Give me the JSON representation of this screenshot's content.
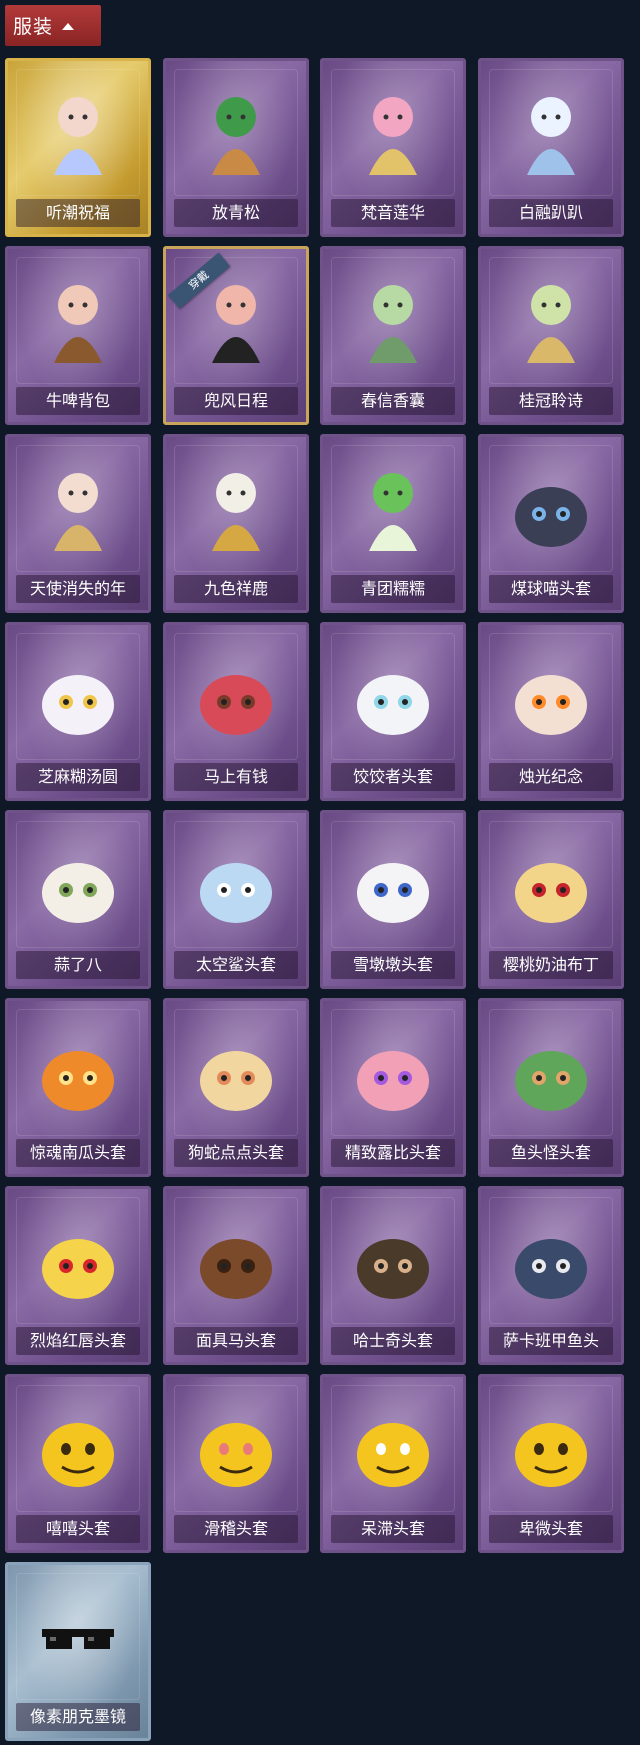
{
  "header": {
    "label": "服装"
  },
  "colors": {
    "background": "#0f1826",
    "header_button": "#9a2c2c",
    "card_purple": "#7a5b96",
    "card_gold": "#d7b548",
    "card_blue": "#94aec4"
  },
  "items": [
    {
      "name": "听潮祝福",
      "tier": "gold",
      "icon": "angel-figure-icon"
    },
    {
      "name": "放青松",
      "tier": "purple",
      "icon": "bonsai-pine-icon"
    },
    {
      "name": "梵音莲华",
      "tier": "purple",
      "icon": "pink-hair-figure-icon"
    },
    {
      "name": "白融趴趴",
      "tier": "purple",
      "icon": "white-cat-plush-icon"
    },
    {
      "name": "牛啤背包",
      "tier": "purple",
      "icon": "cow-beer-barrel-icon"
    },
    {
      "name": "兜风日程",
      "tier": "purple",
      "icon": "cap-girl-figure-icon",
      "equipped": true,
      "badge": "穿戴"
    },
    {
      "name": "春信香囊",
      "tier": "purple",
      "icon": "scent-sachet-icon"
    },
    {
      "name": "桂冠聆诗",
      "tier": "purple",
      "icon": "laurel-fairy-charm-icon"
    },
    {
      "name": "天使消失的年",
      "tier": "purple",
      "icon": "angel-girl-figure-icon"
    },
    {
      "name": "九色祥鹿",
      "tier": "purple",
      "icon": "deer-charm-icon"
    },
    {
      "name": "青团糯糯",
      "tier": "purple",
      "icon": "green-rice-ball-icon"
    },
    {
      "name": "煤球喵头套",
      "tier": "purple",
      "icon": "black-cat-head-icon"
    },
    {
      "name": "芝麻糊汤圆",
      "tier": "purple",
      "icon": "rice-dumpling-head-icon"
    },
    {
      "name": "马上有钱",
      "tier": "purple",
      "icon": "red-horse-head-icon"
    },
    {
      "name": "饺饺者头套",
      "tier": "purple",
      "icon": "dumpling-cloud-head-icon"
    },
    {
      "name": "烛光纪念",
      "tier": "purple",
      "icon": "candle-head-icon"
    },
    {
      "name": "蒜了八",
      "tier": "purple",
      "icon": "garlic-head-icon"
    },
    {
      "name": "太空鲨头套",
      "tier": "purple",
      "icon": "shark-head-icon"
    },
    {
      "name": "雪墩墩头套",
      "tier": "purple",
      "icon": "snowman-head-icon"
    },
    {
      "name": "樱桃奶油布丁",
      "tier": "purple",
      "icon": "pudding-head-icon"
    },
    {
      "name": "惊魂南瓜头套",
      "tier": "purple",
      "icon": "pumpkin-head-icon"
    },
    {
      "name": "狗蛇点点头套",
      "tier": "purple",
      "icon": "snake-head-icon"
    },
    {
      "name": "精致露比头套",
      "tier": "purple",
      "icon": "pink-beaver-head-icon"
    },
    {
      "name": "鱼头怪头套",
      "tier": "purple",
      "icon": "fish-head-icon"
    },
    {
      "name": "烈焰红唇头套",
      "tier": "purple",
      "icon": "yellow-mascot-head-icon"
    },
    {
      "name": "面具马头套",
      "tier": "purple",
      "icon": "horse-mask-icon"
    },
    {
      "name": "哈士奇头套",
      "tier": "purple",
      "icon": "husky-head-icon"
    },
    {
      "name": "萨卡班甲鱼头",
      "tier": "purple",
      "icon": "sacabambaspis-head-icon"
    },
    {
      "name": "嘻嘻头套",
      "tier": "purple",
      "icon": "grin-emoji-head-icon"
    },
    {
      "name": "滑稽头套",
      "tier": "purple",
      "icon": "smirk-emoji-head-icon"
    },
    {
      "name": "呆滞头套",
      "tier": "purple",
      "icon": "stare-emoji-head-icon"
    },
    {
      "name": "卑微头套",
      "tier": "purple",
      "icon": "shy-emoji-head-icon"
    },
    {
      "name": "像素朋克墨镜",
      "tier": "blue",
      "icon": "pixel-sunglasses-icon"
    }
  ]
}
